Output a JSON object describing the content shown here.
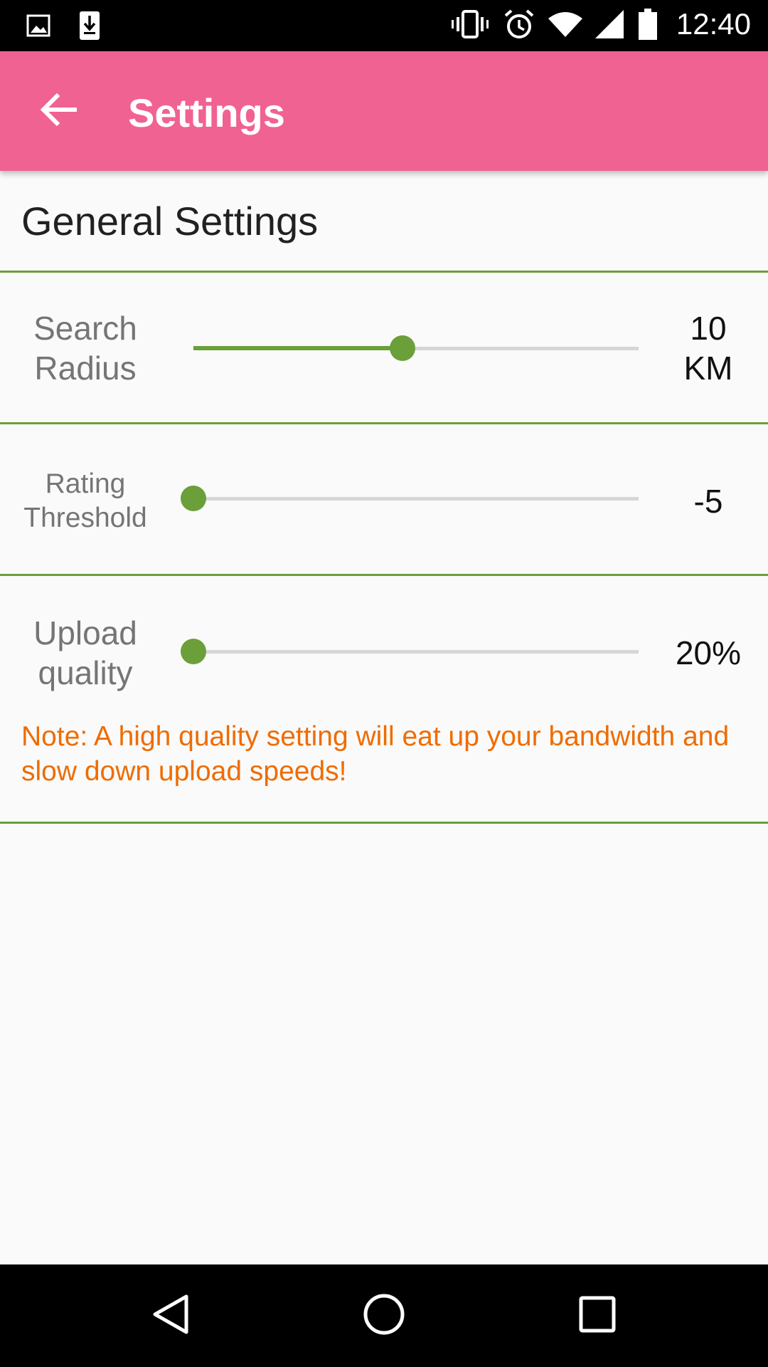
{
  "status_bar": {
    "time": "12:40",
    "left_icons": [
      "image-icon",
      "download-icon"
    ],
    "right_icons": [
      "vibrate-icon",
      "alarm-icon",
      "wifi-icon",
      "cell-signal-icon",
      "battery-icon"
    ]
  },
  "app_bar": {
    "title": "Settings",
    "background": "#f06292",
    "back_icon": "arrow-back-icon"
  },
  "section": {
    "title": "General Settings"
  },
  "settings": {
    "search_radius": {
      "label": "Search Radius",
      "value_number": "10",
      "value_unit": "KM",
      "slider_fraction": 0.47
    },
    "rating_threshold": {
      "label": "Rating Threshold",
      "value": "-5",
      "slider_fraction": 0.0
    },
    "upload_quality": {
      "label": "Upload quality",
      "value": "20%",
      "slider_fraction": 0.0
    }
  },
  "note": "Note:  A high quality setting will eat up your bandwidth and slow down upload speeds!",
  "colors": {
    "accent": "#6b9f3a",
    "note": "#ef6c00",
    "divider": "#6b9f3a"
  },
  "nav_bar": {
    "icons": [
      "back-triangle-icon",
      "home-circle-icon",
      "recents-square-icon"
    ]
  }
}
